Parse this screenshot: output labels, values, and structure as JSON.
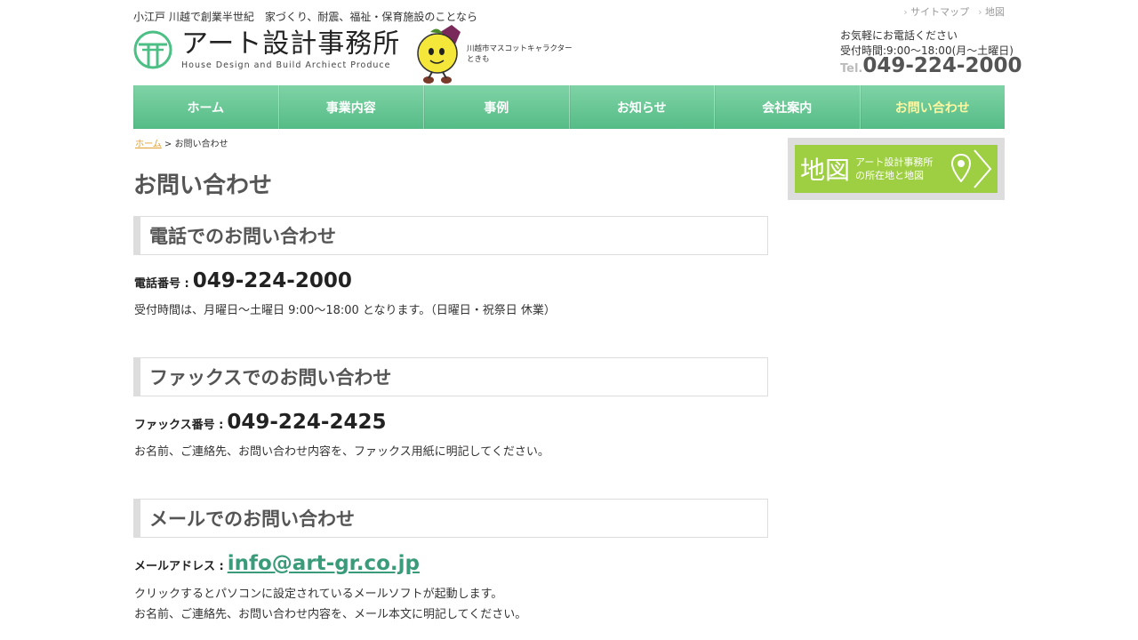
{
  "header": {
    "tagline": "小江戸 川越で創業半世紀　家づくり、耐震、福祉・保育施設のことなら",
    "util_links": [
      "サイトマップ",
      "地図"
    ],
    "logo_jp": "アート設計事務所",
    "logo_en": "House Design and Build Archiect Produce",
    "mascot_caption_1": "川越市マスコットキャラクター",
    "mascot_caption_2": "ときも",
    "contact_line1": "お気軽にお電話ください",
    "contact_line2": "受付時間:9:00～18:00(月～土曜日)",
    "tel_prefix": "Tel.",
    "tel_number": "049-224-2000"
  },
  "nav": {
    "items": [
      "ホーム",
      "事業内容",
      "事例",
      "お知らせ",
      "会社案内",
      "お問い合わせ"
    ],
    "active_index": 5
  },
  "breadcrumb": {
    "home": "ホーム",
    "separator": " > ",
    "current": "お問い合わせ"
  },
  "main": {
    "title": "お問い合わせ",
    "phone": {
      "heading": "電話でのお問い合わせ",
      "label": "電話番号 :",
      "number": "049-224-2000",
      "note": "受付時間は、月曜日〜土曜日 9:00～18:00 となります。（日曜日・祝祭日 休業）"
    },
    "fax": {
      "heading": "ファックスでのお問い合わせ",
      "label": "ファックス番号 :",
      "number": "049-224-2425",
      "note": "お名前、ご連絡先、お問い合わせ内容を、ファックス用紙に明記してください。"
    },
    "mail": {
      "heading": "メールでのお問い合わせ",
      "label": "メールアドレス :",
      "address": "info@art-gr.co.jp",
      "note1": "クリックするとパソコンに設定されているメールソフトが起動します。",
      "note2": "お名前、ご連絡先、お問い合わせ内容を、メール本文に明記してください。"
    }
  },
  "sidebar": {
    "map_banner_big": "地図",
    "map_banner_line1": "アート設計事務所",
    "map_banner_line2": "の所在地と地図"
  },
  "colors": {
    "nav_green": "#5fc28e",
    "active_nav": "#fff8a0",
    "link_green": "#3a9b7b",
    "banner_green": "#9ecf42"
  }
}
